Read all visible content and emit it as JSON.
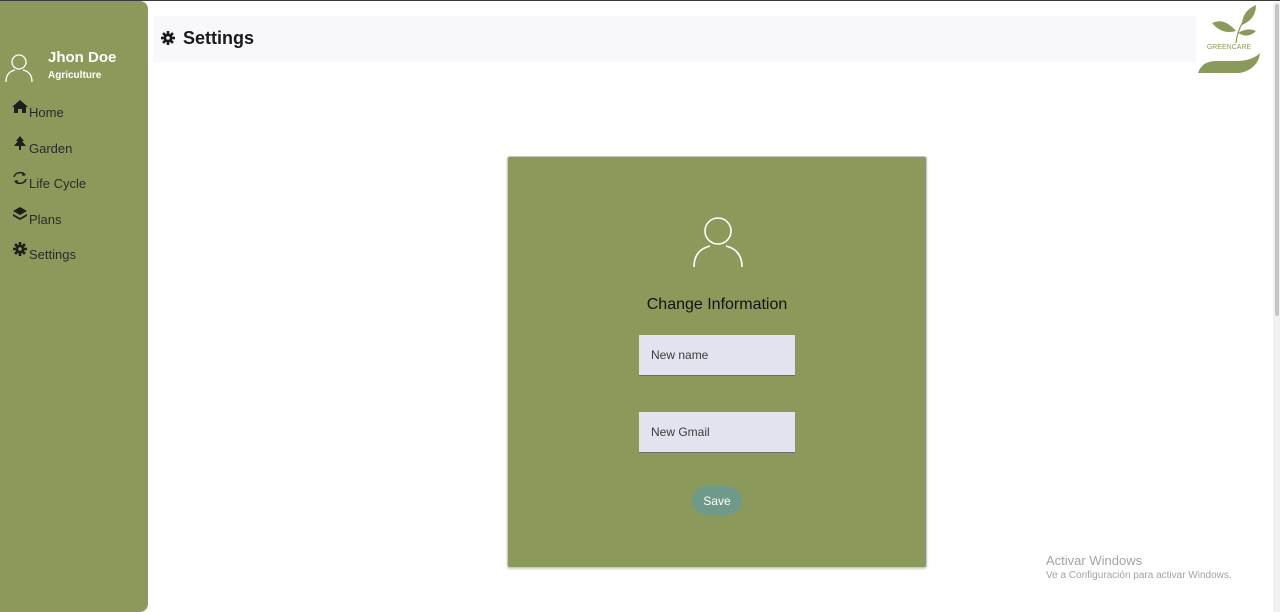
{
  "sidebar": {
    "user": {
      "name": "Jhon Doe",
      "role": "Agriculture"
    },
    "items": [
      {
        "label": "Home",
        "icon": "home-icon"
      },
      {
        "label": "Garden",
        "icon": "tree-icon"
      },
      {
        "label": "Life Cycle",
        "icon": "sync-icon"
      },
      {
        "label": "Plans",
        "icon": "layers-icon"
      },
      {
        "label": "Settings",
        "icon": "gear-icon"
      }
    ]
  },
  "header": {
    "title": "Settings",
    "icon": "gear-icon"
  },
  "logo": {
    "text": "GREENCARE"
  },
  "card": {
    "title": "Change Information",
    "name_placeholder": "New name",
    "gmail_placeholder": "New Gmail",
    "save_label": "Save"
  },
  "watermark": {
    "line1": "Activar Windows",
    "line2": "Ve a Configuración para activar Windows."
  },
  "colors": {
    "sidebar": "#8b9a5b",
    "card": "#8b9a5b",
    "save_button": "#6f9a8a",
    "input_bg": "#e2e3ee"
  }
}
